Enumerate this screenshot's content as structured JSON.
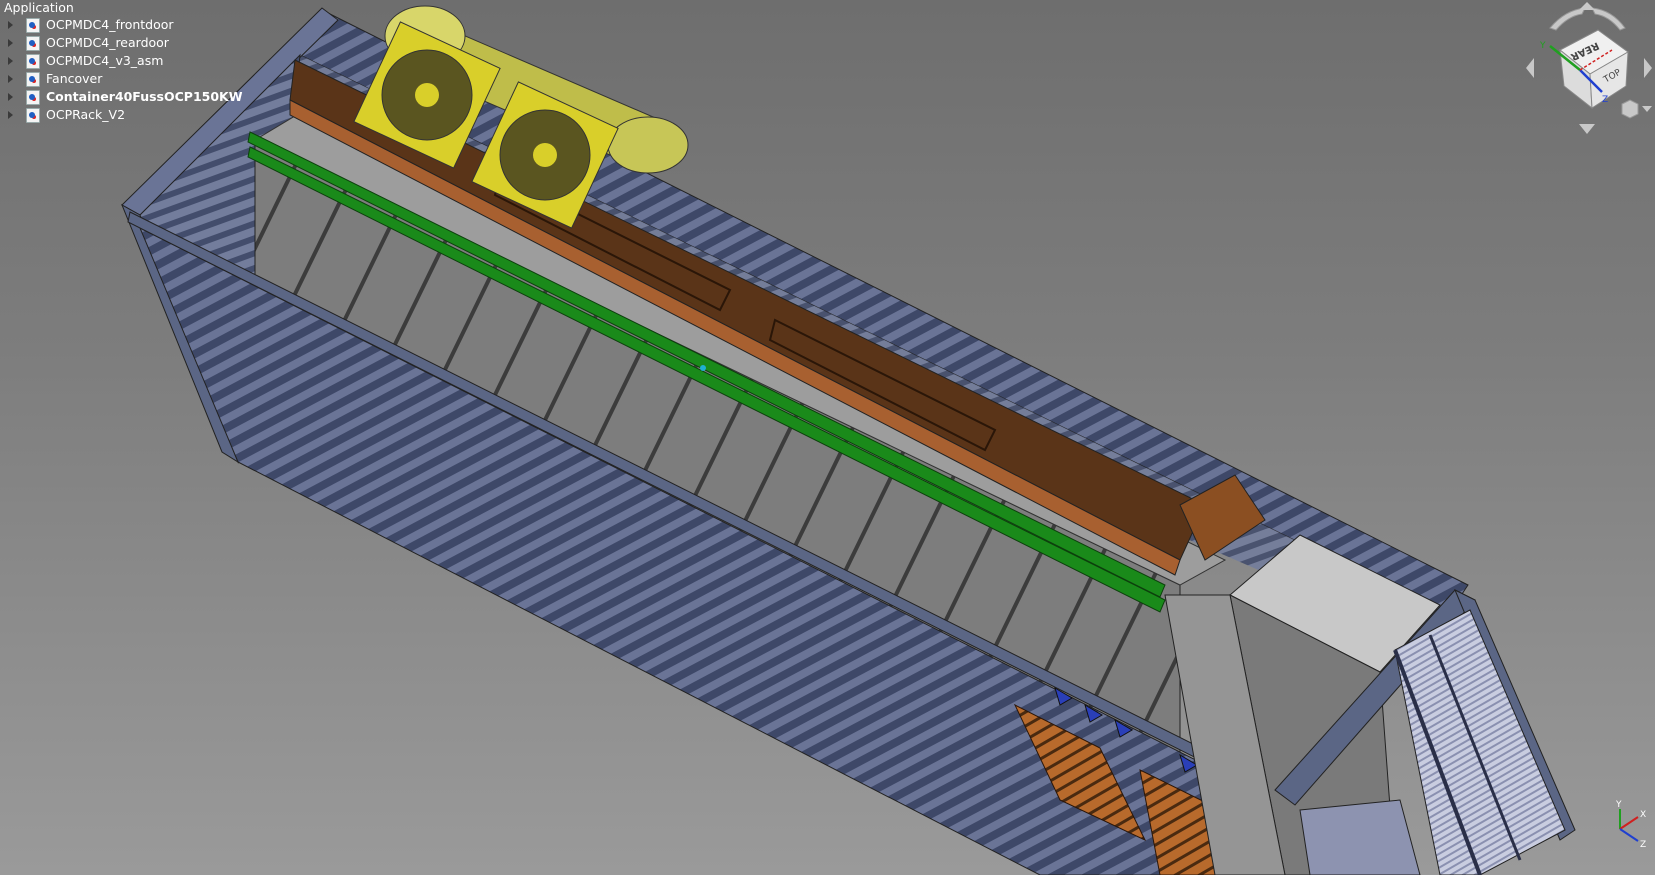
{
  "tree": {
    "root_label": "Application",
    "items": [
      {
        "label": "OCPMDC4_frontdoor",
        "bold": false
      },
      {
        "label": "OCPMDC4_reardoor",
        "bold": false
      },
      {
        "label": "OCPMDC4_v3_asm",
        "bold": false
      },
      {
        "label": "Fancover",
        "bold": false
      },
      {
        "label": "Container40FussOCP150KW",
        "bold": true
      },
      {
        "label": "OCPRack_V2",
        "bold": false
      }
    ]
  },
  "navcube": {
    "face_rear": "REAR",
    "face_top": "TOP",
    "axis_x": "X",
    "axis_y": "Y",
    "axis_z": "Z"
  },
  "axis_indicator": {
    "x": "X",
    "y": "Y",
    "z": "Z",
    "colors": {
      "x": "#d02020",
      "y": "#20a020",
      "z": "#2040d0"
    }
  },
  "colors": {
    "container": "#5b6685",
    "rack": "#8f8f8f",
    "rail": "#1a8a1a",
    "duct": "#5a3418",
    "fan": "#d9cf2a",
    "cylinder": "#c7c657",
    "pallet": "#b86a2c"
  }
}
